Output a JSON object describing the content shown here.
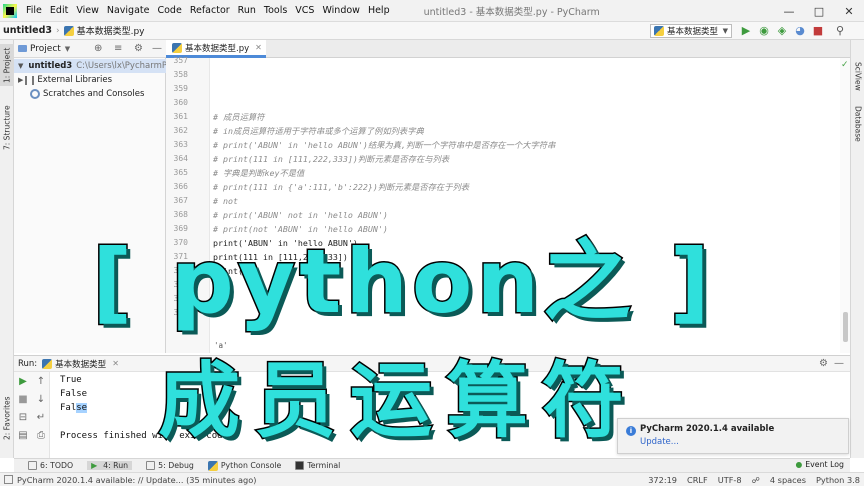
{
  "menubar": {
    "items": [
      "File",
      "Edit",
      "View",
      "Navigate",
      "Code",
      "Refactor",
      "Run",
      "Tools",
      "VCS",
      "Window",
      "Help"
    ],
    "title": "untitled3 - 基本数据类型.py - PyCharm"
  },
  "navbar": {
    "project": "untitled3",
    "file": "基本数据类型.py",
    "run_config": "基本数据类型"
  },
  "left_strip": {
    "project_tab": "1: Project",
    "structure_tab": "7: Structure",
    "favorites_tab": "2: Favorites"
  },
  "right_strip": {
    "sciview_tab": "SciView",
    "database_tab": "Database"
  },
  "project_panel": {
    "header": "Project",
    "root": "untitled3",
    "root_path": "C:\\Users\\lx\\PycharmPr",
    "external_libraries": "External Libraries",
    "scratches": "Scratches and Consoles"
  },
  "editor": {
    "tab_label": "基本数据类型.py",
    "line_numbers": [
      "357",
      "358",
      "359",
      "360",
      "361",
      "362",
      "363",
      "364",
      "365",
      "366",
      "367",
      "368",
      "369",
      "370",
      "371",
      "372",
      "373",
      "374",
      "375"
    ],
    "lines": {
      "l361": "# 成员运算符",
      "l362": "# in成员运算符适用于字符串或多个运算了例如列表字典",
      "l363": "# print('ABUN' in 'hello ABUN')结果为真,判断一个字符串中是否存在一个大字符串",
      "l364": "# print(111 in [111,222,333])判断元素是否存在与列表",
      "l365": "# 字典是判断key不是值",
      "l366": "# print(111 in {'a':111,'b':222})判断元素是否存在于列表",
      "l367": "# not",
      "l368": "# print('ABUN' not in 'hello ABUN')",
      "l369": "# print(not 'ABUN' in 'hello ABUN')",
      "l370": "print('ABUN' in 'hello ABUN')",
      "l371": "print(111 in [111,222,333])",
      "l372": "print("
    },
    "crumb": "'a'"
  },
  "run_panel": {
    "label": "Run:",
    "config": "基本数据类型",
    "output": [
      "True",
      "False",
      "False",
      "",
      "Process finished with exit code 0"
    ]
  },
  "notification": {
    "title": "PyCharm 2020.1.4 available",
    "link": "Update..."
  },
  "tool_tabs": {
    "todo": "6: TODO",
    "run": "4: Run",
    "debug": "5: Debug",
    "python_console": "Python Console",
    "terminal": "Terminal",
    "event_log": "Event Log"
  },
  "status_bar": {
    "message": "PyCharm 2020.1.4 available: // Update... (35 minutes ago)",
    "position": "372:19",
    "line_sep": "CRLF",
    "encoding": "UTF-8",
    "indent": "4 spaces",
    "interpreter": "Python 3.8"
  },
  "overlay": {
    "line1": "[ python之 ]",
    "line2": "成员运算符"
  },
  "colors": {
    "overlay_fill": "#2fe0dc",
    "comment": "#8c8c8c",
    "string": "#067d17",
    "link": "#2f65ca"
  }
}
